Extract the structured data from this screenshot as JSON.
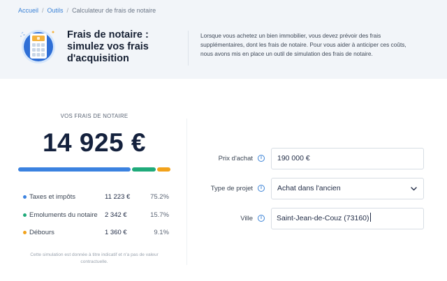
{
  "breadcrumb": {
    "items": [
      "Accueil",
      "Outils",
      "Calculateur de frais de notaire"
    ],
    "separator": "/"
  },
  "hero": {
    "title": "Frais de notaire : simulez vos frais d'acquisition",
    "description": "Lorsque vous achetez un bien immobilier, vous devez prévoir des frais supplémentaires, dont les frais de notaire. Pour vous aider à anticiper ces coûts, nous avons mis en place un outil de simulation des frais de notaire.",
    "icon": "calculator-icon"
  },
  "result": {
    "label": "VOS FRAIS DE NOTAIRE",
    "total": "14 925 €",
    "breakdown": [
      {
        "label": "Taxes et impôts",
        "amount": "11 223 €",
        "percent": "75.2%",
        "share": 0.752,
        "color": "#3b82e0"
      },
      {
        "label": "Emoluments du notaire",
        "amount": "2 342 €",
        "percent": "15.7%",
        "share": 0.157,
        "color": "#1faa7a"
      },
      {
        "label": "Débours",
        "amount": "1 360 €",
        "percent": "9.1%",
        "share": 0.091,
        "color": "#f2a21b"
      }
    ],
    "disclaimer": "Cette simulation est donnée à titre indicatif et n'a pas de valeur contractuelle."
  },
  "form": {
    "price": {
      "label": "Prix d'achat",
      "value": "190 000 €"
    },
    "project_type": {
      "label": "Type de projet",
      "value": "Achat dans l'ancien"
    },
    "city": {
      "label": "Ville",
      "value": "Saint-Jean-de-Couz (73160)"
    }
  },
  "colors": {
    "accent": "#3b82d6",
    "header_bg": "#f2f5f9"
  }
}
